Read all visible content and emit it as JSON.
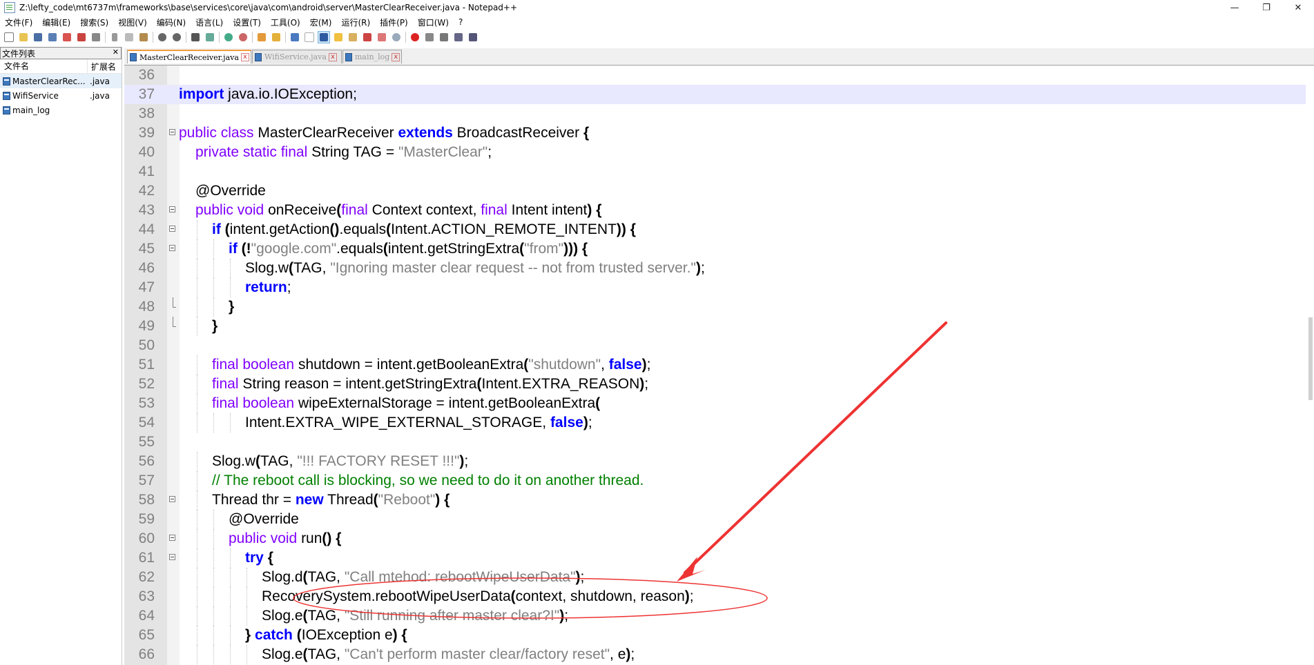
{
  "window": {
    "title": "Z:\\lefty_code\\mt6737m\\frameworks\\base\\services\\core\\java\\com\\android\\server\\MasterClearReceiver.java - Notepad++",
    "minimize": "—",
    "restore": "❐",
    "close": "✕"
  },
  "menu": [
    "文件(F)",
    "编辑(E)",
    "搜索(S)",
    "视图(V)",
    "编码(N)",
    "语言(L)",
    "设置(T)",
    "工具(O)",
    "宏(M)",
    "运行(R)",
    "插件(P)",
    "窗口(W)",
    "?"
  ],
  "file_panel": {
    "title": "文件列表",
    "close": "✕",
    "col_name": "文件名",
    "col_ext": "扩展名",
    "files": [
      {
        "name": "MasterClearRec...",
        "ext": ".java"
      },
      {
        "name": "WifiService",
        "ext": ".java"
      },
      {
        "name": "main_log",
        "ext": ""
      }
    ]
  },
  "tabs": [
    {
      "label": "MasterClearReceiver.java",
      "close": "x"
    },
    {
      "label": "WifiService.java",
      "close": "x"
    },
    {
      "label": "main_log",
      "close": "x"
    }
  ],
  "code_lines": [
    {
      "n": "36",
      "html": ""
    },
    {
      "n": "37",
      "html": "<span class=\"kw\">import</span> java.io.IOException;"
    },
    {
      "n": "38",
      "html": ""
    },
    {
      "n": "39",
      "html": "<span class=\"kw2\">public class</span> MasterClearReceiver <span class=\"kw\">extends</span> BroadcastReceiver <b>{</b>"
    },
    {
      "n": "40",
      "html": "    <span class=\"kw2\">private static final</span> String TAG = <span class=\"str\">\"MasterClear\"</span>;"
    },
    {
      "n": "41",
      "html": ""
    },
    {
      "n": "42",
      "html": "    @Override"
    },
    {
      "n": "43",
      "html": "    <span class=\"kw2\">public void</span> onReceive<b>(</b><span class=\"kw2\">final</span> Context context, <span class=\"kw2\">final</span> Intent intent<b>)</b> <b>{</b>"
    },
    {
      "n": "44",
      "html": "        <span class=\"kw\">if</span> <b>(</b>intent.getAction<b>()</b>.equals<b>(</b>Intent.ACTION_REMOTE_INTENT<b>))</b> <b>{</b>"
    },
    {
      "n": "45",
      "html": "            <span class=\"kw\">if</span> <b>(!</b><span class=\"str\">\"google.com\"</span>.equals<b>(</b>intent.getStringExtra<b>(</b><span class=\"str\">\"from\"</span><b>)))</b> <b>{</b>"
    },
    {
      "n": "46",
      "html": "                Slog.w<b>(</b>TAG, <span class=\"str\">\"Ignoring master clear request -- not from trusted server.\"</span><b>)</b>;"
    },
    {
      "n": "47",
      "html": "                <span class=\"kw\">return</span>;"
    },
    {
      "n": "48",
      "html": "            <b>}</b>"
    },
    {
      "n": "49",
      "html": "        <b>}</b>"
    },
    {
      "n": "50",
      "html": ""
    },
    {
      "n": "51",
      "html": "        <span class=\"kw2\">final boolean</span> shutdown = intent.getBooleanExtra<b>(</b><span class=\"str\">\"shutdown\"</span>, <span class=\"kw\">false</span><b>)</b>;"
    },
    {
      "n": "52",
      "html": "        <span class=\"kw2\">final</span> String reason = intent.getStringExtra<b>(</b>Intent.EXTRA_REASON<b>)</b>;"
    },
    {
      "n": "53",
      "html": "        <span class=\"kw2\">final boolean</span> wipeExternalStorage = intent.getBooleanExtra<b>(</b>"
    },
    {
      "n": "54",
      "html": "                Intent.EXTRA_WIPE_EXTERNAL_STORAGE, <span class=\"kw\">false</span><b>)</b>;"
    },
    {
      "n": "55",
      "html": ""
    },
    {
      "n": "56",
      "html": "        Slog.w<b>(</b>TAG, <span class=\"str\">\"!!! FACTORY RESET !!!\"</span><b>)</b>;"
    },
    {
      "n": "57",
      "html": "        <span class=\"cmt\">// The reboot call is blocking, so we need to do it on another thread.</span>"
    },
    {
      "n": "58",
      "html": "        Thread thr = <span class=\"kw\">new</span> Thread<b>(</b><span class=\"str\">\"Reboot\"</span><b>)</b> <b>{</b>"
    },
    {
      "n": "59",
      "html": "            @Override"
    },
    {
      "n": "60",
      "html": "            <span class=\"kw2\">public void</span> run<b>()</b> <b>{</b>"
    },
    {
      "n": "61",
      "html": "                <span class=\"kw\">try</span> <b>{</b>"
    },
    {
      "n": "62",
      "html": "                    Slog.d<b>(</b>TAG, <span class=\"str\">\"Call mtehod: rebootWipeUserData\"</span><b>)</b>;"
    },
    {
      "n": "63",
      "html": "                    RecoverySystem.rebootWipeUserData<b>(</b>context, shutdown, reason<b>)</b>;"
    },
    {
      "n": "64",
      "html": "                    Slog.e<b>(</b>TAG, <span class=\"str\">\"Still running after master clear?!\"</span><b>)</b>;"
    },
    {
      "n": "65",
      "html": "                <b>}</b> <span class=\"kw\">catch</span> <b>(</b>IOException e<b>)</b> <b>{</b>"
    },
    {
      "n": "66",
      "html": "                    Slog.e<b>(</b>TAG, <span class=\"str\">\"Can't perform master clear/factory reset\"</span>, e<b>)</b>;"
    }
  ],
  "current_line": "37",
  "fold_open_lines": [
    "39",
    "43",
    "44",
    "45",
    "58",
    "60",
    "61"
  ],
  "fold_end_lines": [
    "48",
    "49"
  ],
  "colors": {
    "keyword": "#0000ff",
    "keyword_type": "#8000ff",
    "string": "#808080",
    "comment": "#008000",
    "annotation": "#ee3333"
  }
}
